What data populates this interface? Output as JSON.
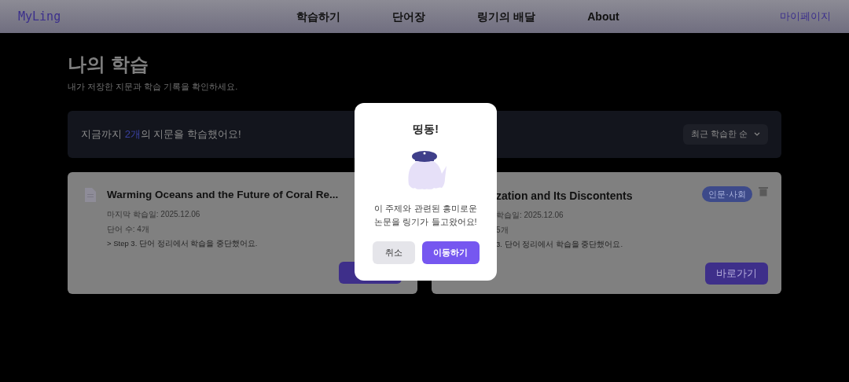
{
  "header": {
    "logo": "MyLing",
    "nav": [
      {
        "label": "학습하기"
      },
      {
        "label": "단어장"
      },
      {
        "label": "링기의 배달"
      },
      {
        "label": "About"
      }
    ],
    "mypage": "마이페이지"
  },
  "page": {
    "title": "나의 학습",
    "subtitle": "내가 저장한 지문과 학습 기록을 확인하세요."
  },
  "summary": {
    "text": "지금까지 **2개**의 지문을 학습했어요!",
    "sort": "최근 학습한 순"
  },
  "cards": [
    {
      "kind": "left",
      "title": "Warming Oceans and the Future of Coral Re...",
      "date": "마지막 학습일: 2025.12.06",
      "words": "단어 수: 4개",
      "step": "> Step 3. 단어 정리에서 학습을 중단했어요."
    },
    {
      "kind": "right",
      "title": "zation and Its Discontents",
      "tag": "인문·사회",
      "date": "학습일: 2025.12.06",
      "words": "5개",
      "step": "3. 단어 정리에서 학습을 중단했어요.",
      "button": "바로가기"
    }
  ],
  "modal": {
    "title": "띵동!",
    "message": "이 주제와 관련된 흥미로운\n논문을 링기가 들고왔어요!",
    "cancel": "취소",
    "confirm": "이동하기"
  }
}
